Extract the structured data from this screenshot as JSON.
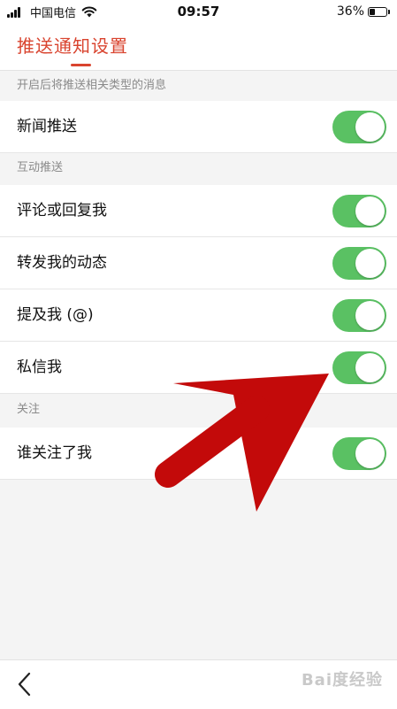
{
  "status_bar": {
    "carrier": "中国电信",
    "time": "09:57",
    "battery_percent": "36%",
    "battery_level": 0.36
  },
  "header": {
    "title": "推送通知设置"
  },
  "sections": [
    {
      "header": "开启后将推送相关类型的消息",
      "rows": [
        {
          "label": "新闻推送",
          "enabled": true
        }
      ]
    },
    {
      "header": "互动推送",
      "rows": [
        {
          "label": "评论或回复我",
          "enabled": true
        },
        {
          "label": "转发我的动态",
          "enabled": true
        },
        {
          "label": "提及我 (@)",
          "enabled": true
        },
        {
          "label": "私信我",
          "enabled": true
        }
      ]
    },
    {
      "header": "关注",
      "rows": [
        {
          "label": "谁关注了我",
          "enabled": true
        }
      ]
    }
  ],
  "footer": {
    "back_icon": "chevron-left-icon",
    "watermark": "Bai度经验"
  },
  "colors": {
    "accent": "#d9442f",
    "toggle_on": "#5ac163",
    "annotation_arrow": "#c30a0a"
  }
}
